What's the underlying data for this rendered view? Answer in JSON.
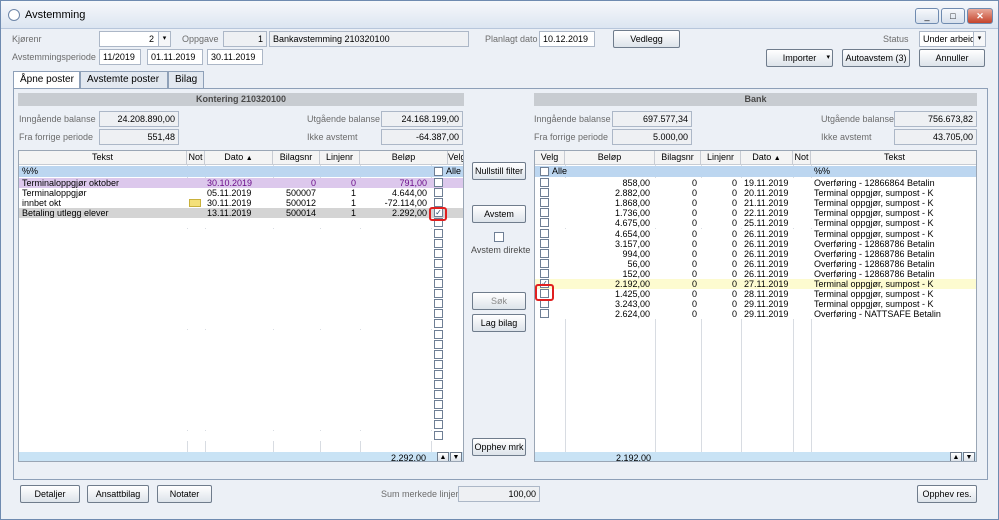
{
  "window": {
    "title": "Avstemming",
    "minimize": "_",
    "maximize": "□",
    "close": "✕"
  },
  "header": {
    "kjorenr_label": "Kjørenr",
    "kjorenr": "2",
    "oppgave_label": "Oppgave",
    "oppgave": "1",
    "oppgave_name": "Bankavstemming 210320100",
    "planlagt_label": "Planlagt dato",
    "planlagt": "10.12.2019",
    "vedlegg": "Vedlegg",
    "status_label": "Status",
    "status": "Under arbeid",
    "periode_label": "Avstemmingsperiode",
    "periode": "11/2019",
    "fra": "01.11.2019",
    "til": "30.11.2019",
    "importer": "Importer",
    "autoavstem": "Autoavstem (3)",
    "annuller": "Annuller"
  },
  "tabs": [
    {
      "label": "Åpne poster"
    },
    {
      "label": "Avstemte poster"
    },
    {
      "label": "Bilag"
    }
  ],
  "left": {
    "title": "Kontering 210320100",
    "inngaende_label": "Inngående balanse",
    "inngaende": "24.208.890,00",
    "fra_label": "Fra forrige periode",
    "fra": "551,48",
    "utgaende_label": "Utgående balanse",
    "utgaende": "24.168.199,00",
    "ikke_label": "Ikke avstemt",
    "ikke": "-64.387,00",
    "columns": [
      "Tekst",
      "Not",
      "Dato",
      "Bilagsnr",
      "Linjenr",
      "Beløp",
      "Velg"
    ],
    "sort_icon": "▲",
    "alle_label": "Alle",
    "filter_row": "%%",
    "rows": [
      {
        "tekst": "Terminaloppgjør oktober",
        "not": "",
        "dato": "30.10.2019",
        "bilag": "0",
        "linje": "0",
        "belop": "791,00"
      },
      {
        "tekst": "Terminaloppgjør",
        "not": "",
        "dato": "05.11.2019",
        "bilag": "500007",
        "linje": "1",
        "belop": "4.644,00"
      },
      {
        "tekst": "innbet okt",
        "not": "note",
        "dato": "30.11.2019",
        "bilag": "500012",
        "linje": "1",
        "belop": "-72.114,00"
      },
      {
        "tekst": "Betaling utlegg elever",
        "not": "",
        "dato": "13.11.2019",
        "bilag": "500014",
        "linje": "1",
        "belop": "2.292,00"
      }
    ],
    "sum": "2.292,00"
  },
  "middle": {
    "nullstill": "Nullstill filter",
    "avstem": "Avstem",
    "avstem_direkte": "Avstem direkte",
    "sok": "Søk",
    "lag_bilag": "Lag bilag",
    "opphev_mrk": "Opphev mrk"
  },
  "right": {
    "title": "Bank",
    "inngaende_label": "Inngående balanse",
    "inngaende": "697.577,34",
    "fra_label": "Fra forrige periode",
    "fra": "5.000,00",
    "utgaende_label": "Utgående balanse",
    "utgaende": "756.673,82",
    "ikke_label": "Ikke avstemt",
    "ikke": "43.705,00",
    "columns": [
      "Velg",
      "Beløp",
      "Bilagsnr",
      "Linjenr",
      "Dato",
      "Not",
      "Tekst"
    ],
    "alle_label": "Alle",
    "filter_row": "%%",
    "rows": [
      {
        "belop": "858,00",
        "bilag": "0",
        "linje": "0",
        "dato": "19.11.2019",
        "tekst": "Overføring - 12866864 Betalin"
      },
      {
        "belop": "2.882,00",
        "bilag": "0",
        "linje": "0",
        "dato": "20.11.2019",
        "tekst": "Terminal oppgjør, sumpost - K"
      },
      {
        "belop": "1.868,00",
        "bilag": "0",
        "linje": "0",
        "dato": "21.11.2019",
        "tekst": "Terminal oppgjør, sumpost - K"
      },
      {
        "belop": "1.736,00",
        "bilag": "0",
        "linje": "0",
        "dato": "22.11.2019",
        "tekst": "Terminal oppgjør, sumpost - K"
      },
      {
        "belop": "4.675,00",
        "bilag": "0",
        "linje": "0",
        "dato": "25.11.2019",
        "tekst": "Terminal oppgjør, sumpost - K"
      },
      {
        "belop": "4.654,00",
        "bilag": "0",
        "linje": "0",
        "dato": "26.11.2019",
        "tekst": "Terminal oppgjør, sumpost - K"
      },
      {
        "belop": "3.157,00",
        "bilag": "0",
        "linje": "0",
        "dato": "26.11.2019",
        "tekst": "Overføring - 12868786 Betalin"
      },
      {
        "belop": "994,00",
        "bilag": "0",
        "linje": "0",
        "dato": "26.11.2019",
        "tekst": "Overføring - 12868786 Betalin"
      },
      {
        "belop": "56,00",
        "bilag": "0",
        "linje": "0",
        "dato": "26.11.2019",
        "tekst": "Overføring - 12868786 Betalin"
      },
      {
        "belop": "152,00",
        "bilag": "0",
        "linje": "0",
        "dato": "26.11.2019",
        "tekst": "Overføring - 12868786 Betalin"
      },
      {
        "belop": "2.192,00",
        "bilag": "0",
        "linje": "0",
        "dato": "27.11.2019",
        "tekst": "Terminal oppgjør, sumpost - K"
      },
      {
        "belop": "1.425,00",
        "bilag": "0",
        "linje": "0",
        "dato": "28.11.2019",
        "tekst": "Terminal oppgjør, sumpost - K"
      },
      {
        "belop": "3.243,00",
        "bilag": "0",
        "linje": "0",
        "dato": "29.11.2019",
        "tekst": "Terminal oppgjør, sumpost - K"
      },
      {
        "belop": "2.624,00",
        "bilag": "0",
        "linje": "0",
        "dato": "29.11.2019",
        "tekst": "Overføring - NATTSAFE Betalin"
      }
    ],
    "sum": "2.192,00"
  },
  "footer": {
    "detaljer": "Detaljer",
    "ansattbilag": "Ansattbilag",
    "notater": "Notater",
    "sum_label": "Sum merkede linjer",
    "sum": "100,00",
    "opphev_res": "Opphev res."
  },
  "icons": {
    "check": "✓",
    "sort": "▲",
    "dropdown": "▾",
    "scroll_up": "▲",
    "scroll_down": "▼"
  }
}
